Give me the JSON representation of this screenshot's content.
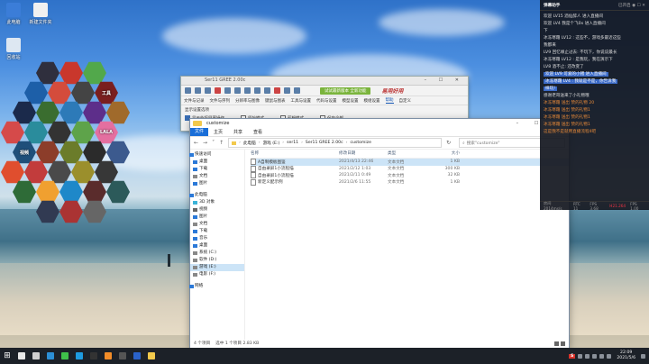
{
  "desktop": {
    "icons": [
      {
        "label": "此电脑",
        "color": "#3b7dd8"
      },
      {
        "label": "新建文件夹",
        "color": "#f0f0f0"
      },
      {
        "label": "回收站",
        "color": "#dde7f2"
      }
    ],
    "hex_dock": [
      {
        "label": "",
        "color": "#2f2f3d"
      },
      {
        "label": "",
        "color": "#c9372c"
      },
      {
        "label": "",
        "color": "#52a84b"
      },
      {
        "label": "",
        "color": "#1d5fa8"
      },
      {
        "label": "",
        "color": "#d44c3c"
      },
      {
        "label": "",
        "color": "#444"
      },
      {
        "label": "工具",
        "color": "#7a1f1f"
      },
      {
        "label": "",
        "color": "#1b2a4b"
      },
      {
        "label": "",
        "color": "#3a6d2f"
      },
      {
        "label": "",
        "color": "#2d7ab8"
      },
      {
        "label": "",
        "color": "#5d2e8a"
      },
      {
        "label": "",
        "color": "#a06a2b"
      },
      {
        "label": "",
        "color": "#d54a4a"
      },
      {
        "label": "",
        "color": "#2a8c9c"
      },
      {
        "label": "",
        "color": "#333"
      },
      {
        "label": "",
        "color": "#5ea34a"
      },
      {
        "label": "LALA",
        "color": "#e46fa0"
      },
      {
        "label": "视频",
        "color": "#1f4f7a"
      },
      {
        "label": "",
        "color": "#8c3d2a"
      },
      {
        "label": "",
        "color": "#6b7c2a"
      },
      {
        "label": "",
        "color": "#2b2b2b"
      },
      {
        "label": "",
        "color": "#3c5a8e"
      },
      {
        "label": "",
        "color": "#e04e2e"
      },
      {
        "label": "",
        "color": "#c23c3c"
      },
      {
        "label": "",
        "color": "#4a4a4a"
      },
      {
        "label": "",
        "color": "#9b8f2c"
      },
      {
        "label": "",
        "color": "#373737"
      },
      {
        "label": "",
        "color": "#2e6b37"
      },
      {
        "label": "",
        "color": "#f0a030"
      },
      {
        "label": "",
        "color": "#1e88c9"
      },
      {
        "label": "",
        "color": "#5a2c2c"
      },
      {
        "label": "",
        "color": "#2c5a5a"
      },
      {
        "label": "",
        "color": "#313a52"
      },
      {
        "label": "",
        "color": "#a33"
      },
      {
        "label": "",
        "color": "#666"
      }
    ]
  },
  "app_window": {
    "title": "Ser11 GREE 2.00c",
    "green_button": "试试最新版本 全新功能",
    "brand": "易用好用",
    "menu": [
      "文件与记录",
      "文件与序列",
      "分辨率与图像",
      "键鼠与图表",
      "工具与设置",
      "代码与设置",
      "模型设置",
      "模组设置",
      "帮助",
      "自定义"
    ],
    "menu_active": 8,
    "panel_label": "显示设置选项",
    "options": [
      "显示外接屏幕操作",
      "原始模式",
      "剪辑模式",
      "保存全部"
    ]
  },
  "explorer": {
    "title": "customize",
    "ribbon": {
      "file": "文件",
      "tabs": [
        "主页",
        "共享",
        "查看"
      ],
      "help": "?"
    },
    "path": [
      "此电脑",
      "游戏 (E:)",
      "ser11",
      "Ser11 GREE 2.00c",
      "customize"
    ],
    "search_placeholder": "搜索\"customize\"",
    "nav": [
      {
        "label": "快速访问",
        "group": true,
        "color": "#2b79d8"
      },
      {
        "label": "桌面",
        "color": "#2b79d8"
      },
      {
        "label": "下载",
        "color": "#2b79d8"
      },
      {
        "label": "文档",
        "color": "#888"
      },
      {
        "label": "图片",
        "color": "#2b79d8"
      },
      {
        "gap": true
      },
      {
        "label": "此电脑",
        "group": true,
        "color": "#2b79d8"
      },
      {
        "label": "3D 对象",
        "color": "#3bb3d8"
      },
      {
        "label": "视频",
        "color": "#666"
      },
      {
        "label": "图片",
        "color": "#2b79d8"
      },
      {
        "label": "文档",
        "color": "#888"
      },
      {
        "label": "下载",
        "color": "#2b79d8"
      },
      {
        "label": "音乐",
        "color": "#2b79d8"
      },
      {
        "label": "桌面",
        "color": "#2b79d8"
      },
      {
        "label": "系统 (C:)",
        "color": "#888"
      },
      {
        "label": "软件 (D:)",
        "color": "#888"
      },
      {
        "label": "游戏 (E:)",
        "color": "#888",
        "selected": true
      },
      {
        "label": "电影 (F:)",
        "color": "#888"
      },
      {
        "gap": true
      },
      {
        "label": "网络",
        "group": true,
        "color": "#2b79d8"
      }
    ],
    "columns": {
      "name": "名称",
      "date": "修改日期",
      "type": "类型",
      "size": "大小"
    },
    "files": [
      {
        "name": "A自制模板图鉴",
        "date": "2021/4/13 22:46",
        "type": "文本文档",
        "size": "1 KB",
        "selected": true
      },
      {
        "name": "自由录屏1小流程描",
        "date": "2021/2/12 1:03",
        "type": "文本文档",
        "size": "300 KB"
      },
      {
        "name": "自由录屏1小流程描",
        "date": "2021/2/11 0:49",
        "type": "文本文档",
        "size": "32 KB"
      },
      {
        "name": "新定义配示例",
        "date": "2021/2/6 11:55",
        "type": "文本文档",
        "size": "1 KB"
      }
    ],
    "status": {
      "count": "4 个项目",
      "selected": "选中 1 个项目 2.83 KB"
    }
  },
  "chat": {
    "title": "弹幕助手",
    "header_right": "已开启 ◉ ☐ ✕",
    "messages": [
      {
        "text": "欢迎 LV15 酒仙醉人 进入直播间",
        "kind": "normal"
      },
      {
        "text": "欢迎 LV4 我是个飞0x 进入直播间",
        "kind": "normal"
      },
      {
        "text": "下",
        "kind": "normal"
      },
      {
        "text": "冰冻寒霜 LV12 : 这些不，游戏多最近这些",
        "kind": "normal"
      },
      {
        "text": "我都来",
        "kind": "normal"
      },
      {
        "text": "LV9 回忆缘止过去: 不玩下，你说说最长",
        "kind": "normal"
      },
      {
        "text": "冰冻寒霜 LV12 : 是我玩，我在演示下",
        "kind": "normal"
      },
      {
        "text": "LV8 酒不止: 还改变了",
        "kind": "normal"
      },
      {
        "text": "欢迎 LV9 可爱的小猪 进入直播间",
        "kind": "highlight"
      },
      {
        "text": "冰冻寒霜 LV4 : 我就是不是，你告诉我",
        "kind": "highlight"
      },
      {
        "text": "样玩!",
        "kind": "highlight"
      },
      {
        "text": "感谢老哥送来了小礼物哦",
        "kind": "normal"
      },
      {
        "text": "冰冻寒霜 送出 赞的礼物 20",
        "kind": "orange"
      },
      {
        "text": "冰冻寒霜 送出 赞的礼物1",
        "kind": "orange"
      },
      {
        "text": "冰冻寒霜 送出 赞的礼物1",
        "kind": "orange"
      },
      {
        "text": "冰冻寒霜 送出 赞的礼物1",
        "kind": "orange"
      },
      {
        "text": "这是我不是就用直播流程4吧",
        "kind": "orange"
      }
    ],
    "footer": [
      "房间 2014ms/s",
      "RTC 11",
      "FPS 3.68",
      "H21.264",
      "FPS 1.00"
    ]
  },
  "taskbar": {
    "apps": [
      {
        "name": "search",
        "color": "#e8e8e8"
      },
      {
        "name": "task-view",
        "color": "#cfcfcf"
      },
      {
        "name": "edge",
        "color": "#2c8fd6"
      },
      {
        "name": "wechat",
        "color": "#3fbf4a"
      },
      {
        "name": "qq",
        "color": "#1e9be0"
      },
      {
        "name": "penguin",
        "color": "#333"
      },
      {
        "name": "app-orange",
        "color": "#f28c28"
      },
      {
        "name": "app-dark",
        "color": "#555"
      },
      {
        "name": "app-blue",
        "color": "#2a62c9"
      },
      {
        "name": "explorer",
        "color": "#f2c94c"
      }
    ],
    "ime": "S",
    "time": "22:09",
    "date": "2021/5/6"
  }
}
